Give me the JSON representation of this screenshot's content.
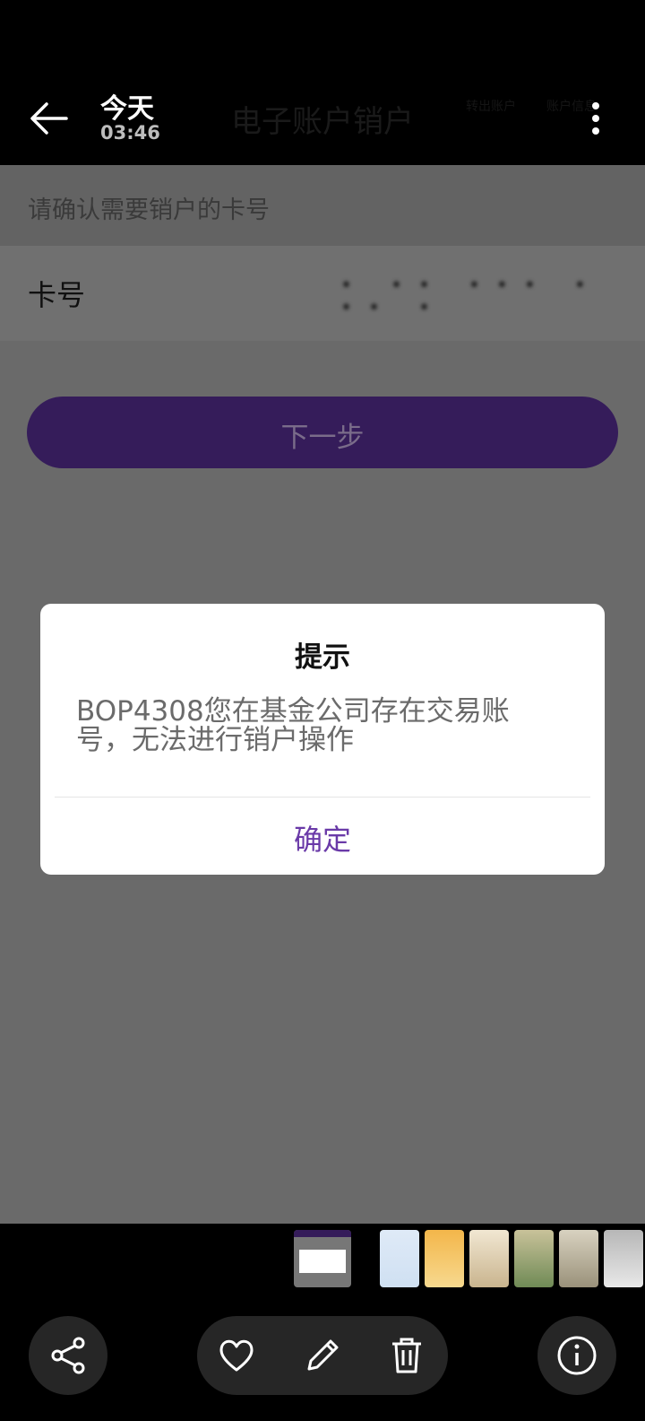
{
  "viewer": {
    "date_label": "今天",
    "time_label": "03:46",
    "icons": [
      "back-arrow-icon",
      "more-vert-icon",
      "share-icon",
      "heart-icon",
      "edit-pencil-icon",
      "trash-icon",
      "info-icon"
    ]
  },
  "app": {
    "title": "电子账户销户",
    "header_ghost_a": "转出账户",
    "header_ghost_b": "账户信息",
    "section_hint": "请确认需要销户的卡号",
    "card_label": "卡号",
    "card_number_masked": "• •• ••• • •• •",
    "next_button": "下一步",
    "accent_color": "#351c5a"
  },
  "dialog": {
    "title": "提示",
    "message": "BOP4308您在基金公司存在交易账号，无法进行销户操作",
    "ok_button": "确定",
    "ok_color": "#6a3aa8"
  }
}
